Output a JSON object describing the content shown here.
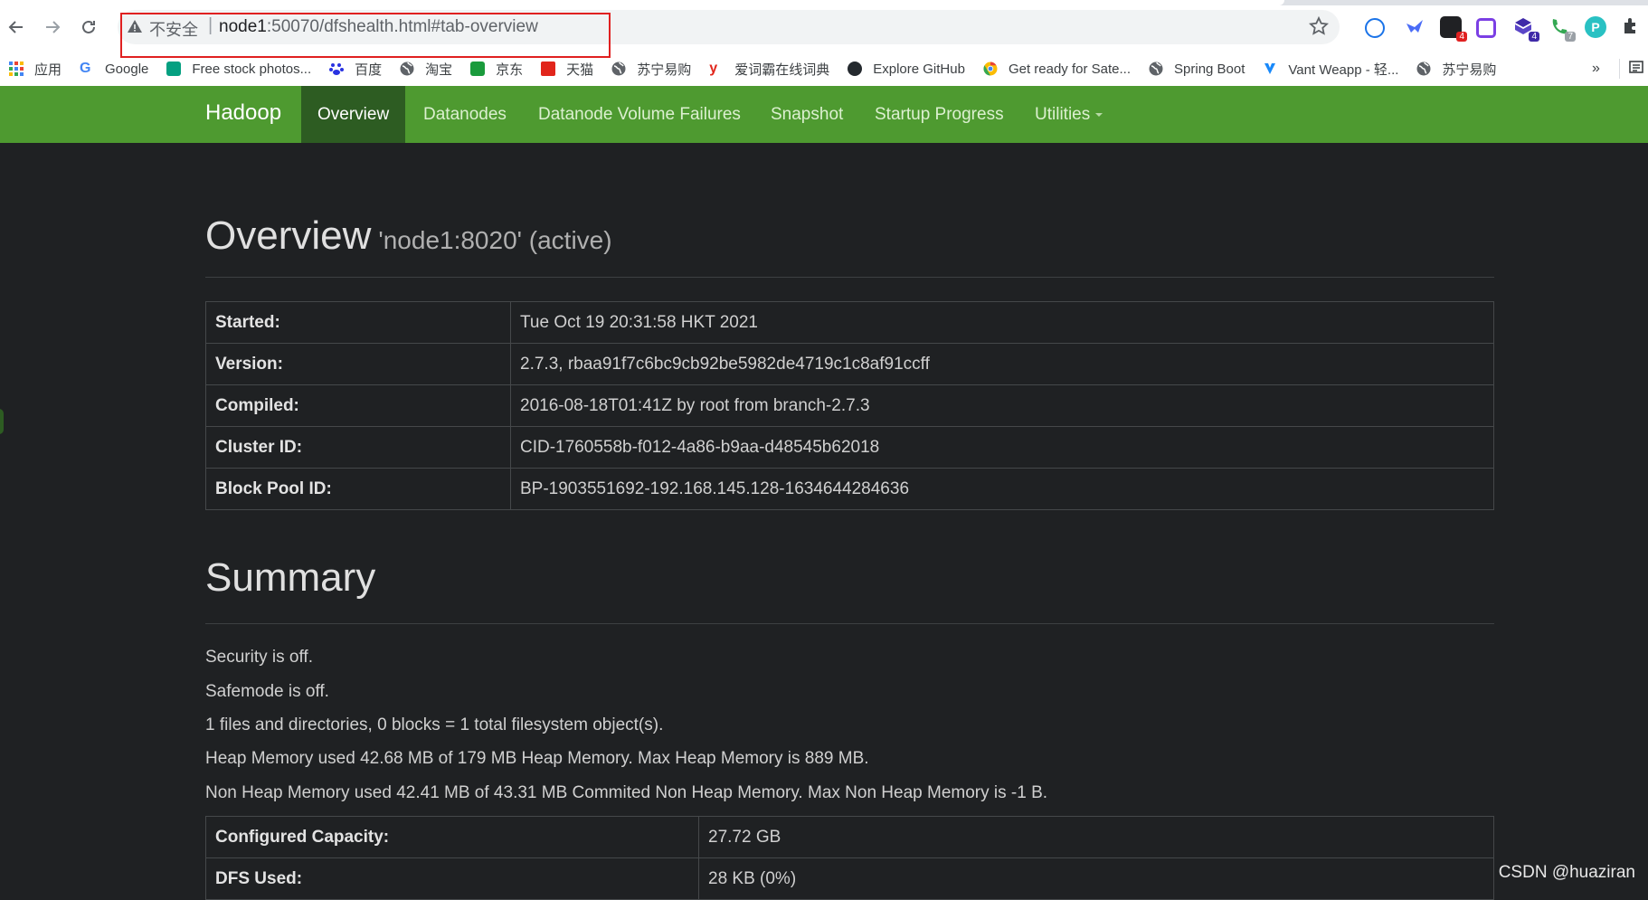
{
  "browser": {
    "insecure_label": "不安全",
    "separator": "|",
    "url_host": "node1",
    "url_rest": ":50070/dfshealth.html#tab-overview",
    "bookmarks": [
      {
        "label": "应用",
        "icon": "apps-grid-icon",
        "color": "#4285f4"
      },
      {
        "label": "Google",
        "icon": "google-icon",
        "color": "#4285f4"
      },
      {
        "label": "Free stock photos...",
        "icon": "pexels-icon",
        "color": "#05a081"
      },
      {
        "label": "百度",
        "icon": "baidu-icon",
        "color": "#2932e1"
      },
      {
        "label": "淘宝",
        "icon": "globe-icon",
        "color": "#5f6368"
      },
      {
        "label": "京东",
        "icon": "jd-icon",
        "color": "#1a9b3c"
      },
      {
        "label": "天猫",
        "icon": "tmall-icon",
        "color": "#e1251b"
      },
      {
        "label": "苏宁易购",
        "icon": "globe-icon",
        "color": "#5f6368"
      },
      {
        "label": "爱词霸在线词典",
        "icon": "iciba-icon",
        "color": "#e1251b"
      },
      {
        "label": "Explore GitHub",
        "icon": "github-icon",
        "color": "#24292e"
      },
      {
        "label": "Get ready for Sate...",
        "icon": "chrome-icon",
        "color": "#fbbc05"
      },
      {
        "label": "Spring Boot",
        "icon": "globe-icon",
        "color": "#5f6368"
      },
      {
        "label": "Vant Weapp - 轻...",
        "icon": "vant-icon",
        "color": "#1989fa"
      },
      {
        "label": "苏宁易购",
        "icon": "globe-icon",
        "color": "#5f6368"
      }
    ],
    "more_label": "»",
    "extensions": [
      {
        "icon": "ext-circle-icon",
        "color": "#1a73e8",
        "badge": ""
      },
      {
        "icon": "ext-bird-icon",
        "color": "#4a6cf7",
        "badge": ""
      },
      {
        "icon": "ext-chat-icon",
        "color": "#202124",
        "badge": "4"
      },
      {
        "icon": "ext-square-icon",
        "color": "#7b3fe4",
        "badge": ""
      },
      {
        "icon": "ext-cube-icon",
        "color": "#3f2aa8",
        "badge": "4"
      },
      {
        "icon": "ext-phone-icon",
        "color": "#34a853",
        "badge": "7"
      },
      {
        "icon": "ext-p-icon",
        "color": "#29c1c3",
        "badge": ""
      }
    ]
  },
  "navbar": {
    "brand": "Hadoop",
    "links": [
      "Overview",
      "Datanodes",
      "Datanode Volume Failures",
      "Snapshot",
      "Startup Progress",
      "Utilities"
    ],
    "accent": "#4e9a30",
    "active_bg": "#2d5c22"
  },
  "overview": {
    "title": "Overview",
    "subtitle": "'node1:8020' (active)",
    "rows": [
      {
        "key": "Started:",
        "value": "Tue Oct 19 20:31:58 HKT 2021"
      },
      {
        "key": "Version:",
        "value": "2.7.3, rbaa91f7c6bc9cb92be5982de4719c1c8af91ccff"
      },
      {
        "key": "Compiled:",
        "value": "2016-08-18T01:41Z by root from branch-2.7.3"
      },
      {
        "key": "Cluster ID:",
        "value": "CID-1760558b-f012-4a86-b9aa-d48545b62018"
      },
      {
        "key": "Block Pool ID:",
        "value": "BP-1903551692-192.168.145.128-1634644284636"
      }
    ]
  },
  "summary": {
    "title": "Summary",
    "lines": [
      "Security is off.",
      "Safemode is off.",
      "1 files and directories, 0 blocks = 1 total filesystem object(s).",
      "Heap Memory used 42.68 MB of 179 MB Heap Memory. Max Heap Memory is 889 MB.",
      "Non Heap Memory used 42.41 MB of 43.31 MB Commited Non Heap Memory. Max Non Heap Memory is -1 B."
    ],
    "rows": [
      {
        "key": "Configured Capacity:",
        "value": "27.72 GB"
      },
      {
        "key": "DFS Used:",
        "value": "28 KB (0%)"
      }
    ]
  },
  "watermark": "CSDN @huaziran"
}
